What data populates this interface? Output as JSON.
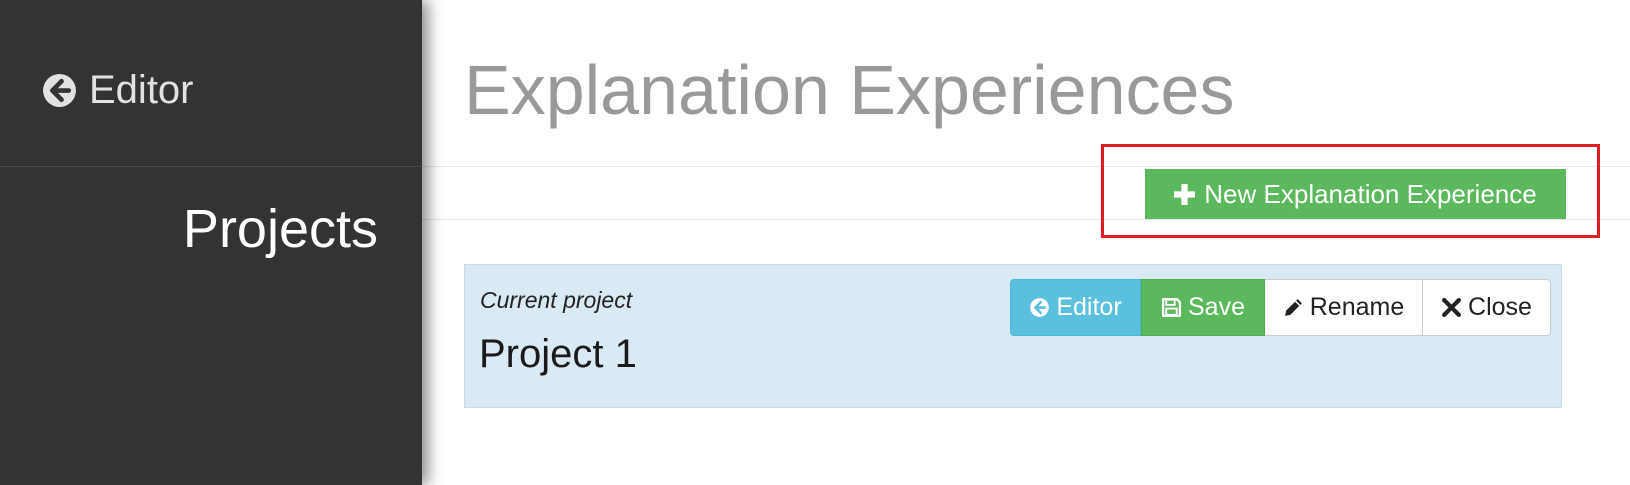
{
  "sidebar": {
    "back_link_label": "Editor",
    "section_title": "Projects"
  },
  "main": {
    "page_title": "Explanation Experiences",
    "new_button_label": "New Explanation Experience",
    "current_project": {
      "label": "Current project",
      "name": "Project 1"
    },
    "actions": {
      "editor_label": "Editor",
      "save_label": "Save",
      "rename_label": "Rename",
      "close_label": "Close"
    }
  },
  "icons": {
    "back": "circle-arrow-left-icon",
    "plus": "plus-icon",
    "save": "floppy-disk-icon",
    "rename": "pencil-icon",
    "close": "close-icon"
  },
  "colors": {
    "sidebar_bg": "#333333",
    "success": "#5cb85c",
    "info": "#5bc0de",
    "panel_bg": "#d9eaf4",
    "highlight": "#e01e26",
    "title_gray": "#999999"
  }
}
